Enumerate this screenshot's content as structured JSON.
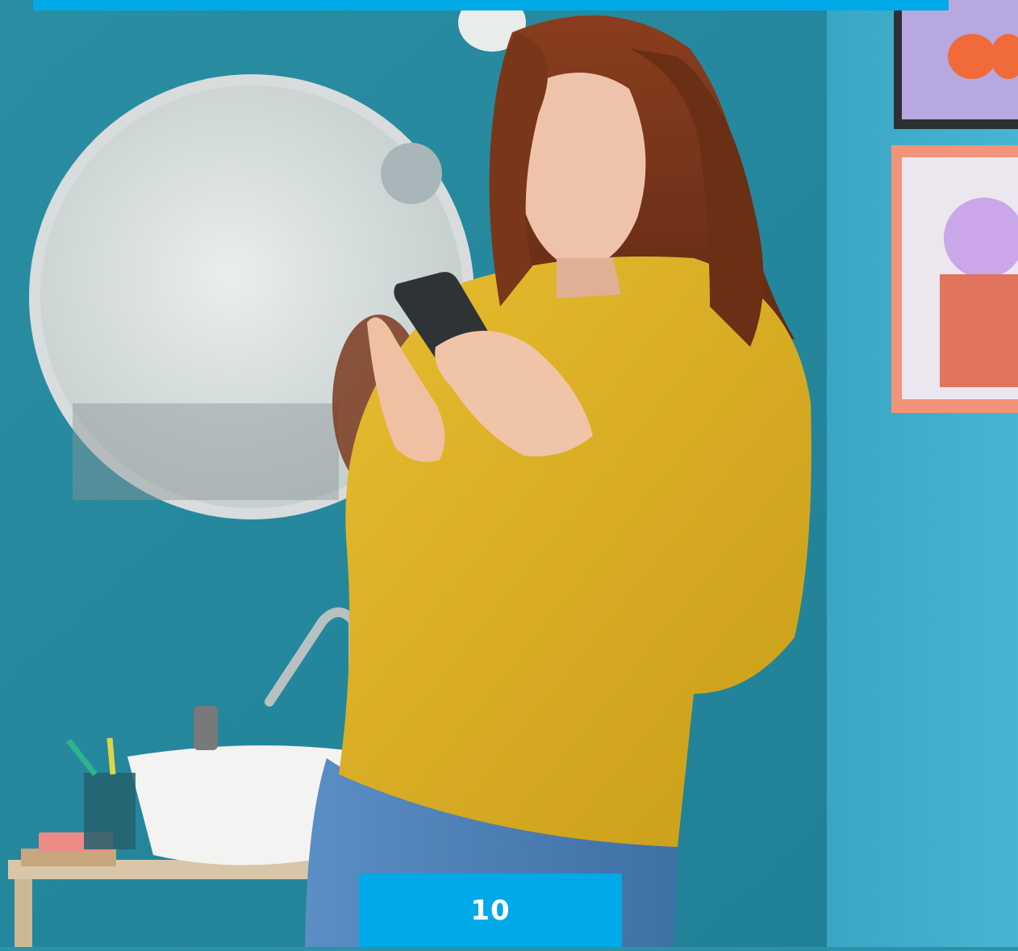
{
  "page": {
    "number": "10"
  },
  "colors": {
    "accent": "#00a9e8",
    "wall": "#2a93a8",
    "sweater": "#e0b52a",
    "jeans": "#4f83b8"
  }
}
